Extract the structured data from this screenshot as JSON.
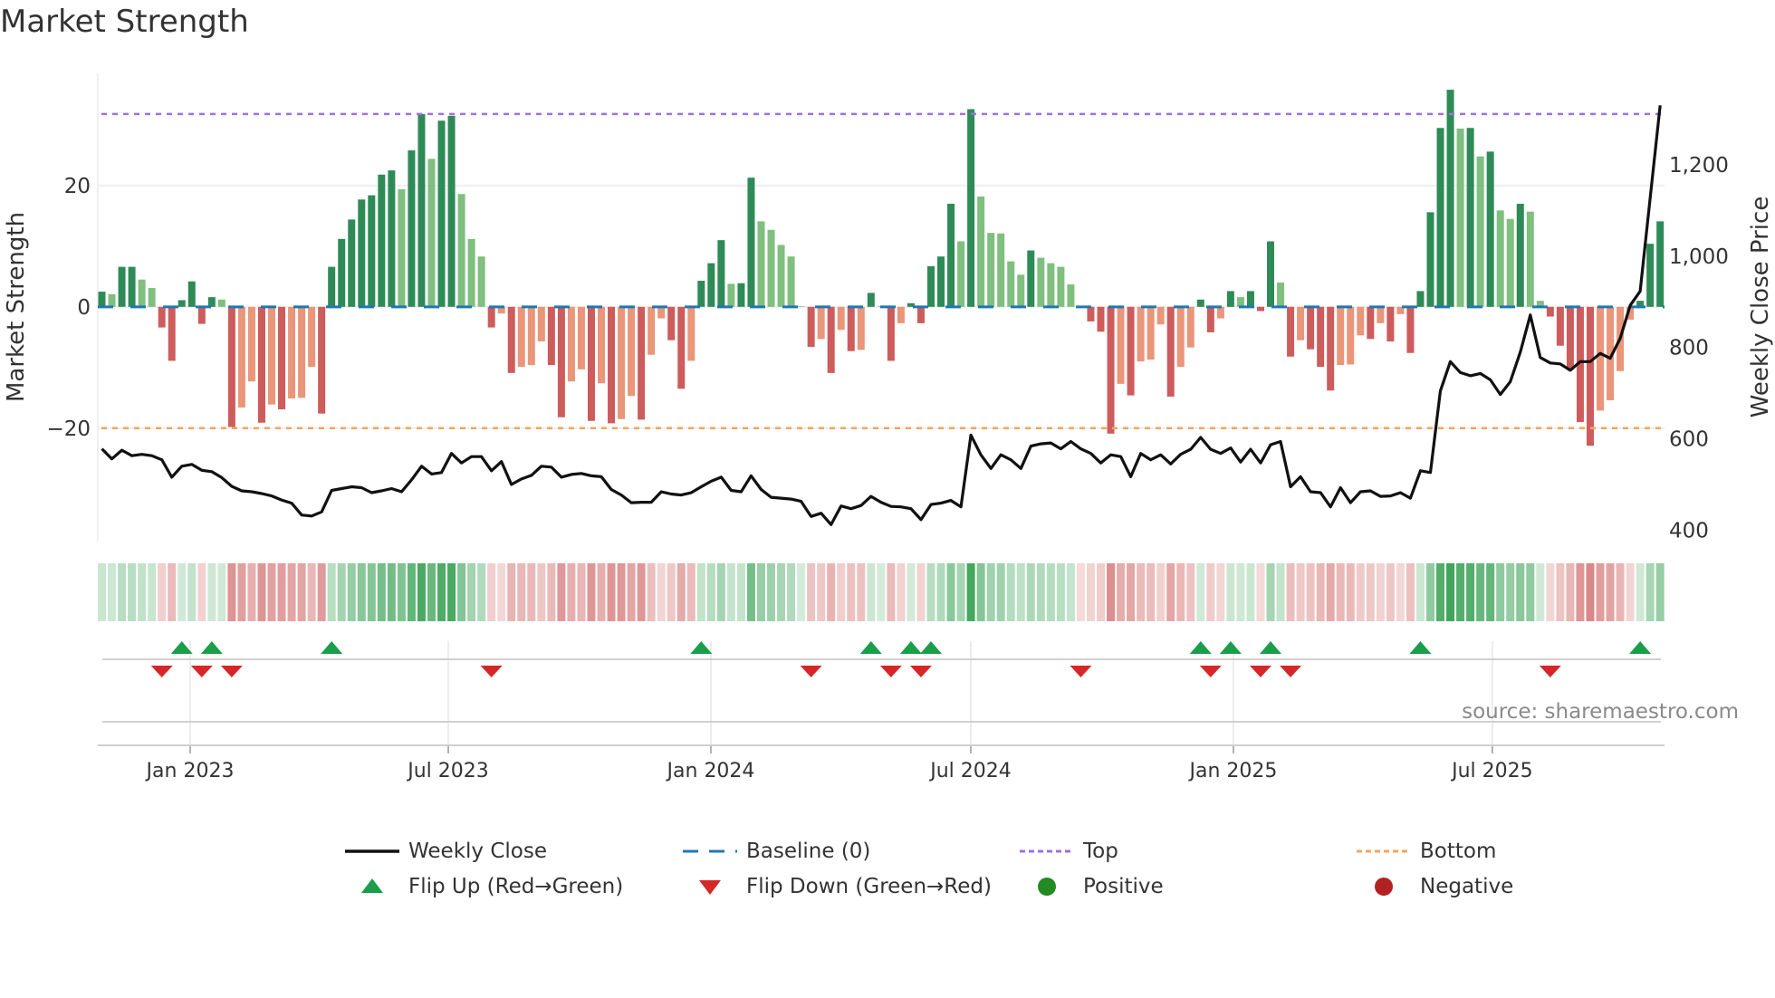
{
  "title": "Market Strength",
  "source": "source: sharemaestro.com",
  "legend": {
    "weekly_close": "Weekly Close",
    "baseline": "Baseline (0)",
    "top": "Top",
    "bottom": "Bottom",
    "flip_up": "Flip Up (Red→Green)",
    "flip_down": "Flip Down (Green→Red)",
    "positive": "Positive",
    "negative": "Negative"
  },
  "colors": {
    "rising_positive": "#2e8b57",
    "falling_positive": "#7fbf7f",
    "falling_negative": "#cd5c5c",
    "rising_negative": "#e9967a",
    "baseline": "#1f77b4",
    "top": "#a070e0",
    "bottom": "#f4a460",
    "line": "#111111",
    "flip_up": "#1a9e4a",
    "flip_down": "#d62728",
    "positive_dot": "#228b22",
    "negative_dot": "#b22222"
  },
  "chart_data": {
    "type": "bar",
    "title": "Market Strength",
    "ylabel": "Market Strength",
    "y2label": "Weekly Close Price",
    "ylim": [
      -38.7,
      38.5
    ],
    "y2lim": [
      375,
      1400
    ],
    "yticks": [
      {
        "v": 20,
        "label": "20"
      },
      {
        "v": 0,
        "label": "0"
      },
      {
        "v": -20,
        "label": "−20"
      }
    ],
    "y2ticks": [
      {
        "v": 1200,
        "label": "1,200"
      },
      {
        "v": 1000,
        "label": "1,000"
      },
      {
        "v": 800,
        "label": "800"
      },
      {
        "v": 600,
        "label": "600"
      },
      {
        "v": 400,
        "label": "400"
      }
    ],
    "top_level": 31.8,
    "bottom_level": -20,
    "xticks": [
      {
        "week": 8.84,
        "label": "Jan 2023"
      },
      {
        "week": 34.68,
        "label": "Jul 2023"
      },
      {
        "week": 60.97,
        "label": "Jan 2024"
      },
      {
        "week": 86.99,
        "label": "Jul 2024"
      },
      {
        "week": 113.28,
        "label": "Jan 2025"
      },
      {
        "week": 139.2,
        "label": "Jul 2025"
      }
    ],
    "strength": [
      2.5,
      2.1,
      6.6,
      6.6,
      4.5,
      3.1,
      -3.4,
      -8.9,
      1.1,
      4.2,
      -2.8,
      1.6,
      1.2,
      -19.8,
      -16.6,
      -12.3,
      -19.1,
      -16.1,
      -16.9,
      -15.1,
      -15.0,
      -9.9,
      -17.6,
      6.6,
      11.2,
      14.4,
      17.7,
      18.4,
      21.8,
      22.5,
      19.4,
      25.8,
      31.8,
      24.4,
      30.7,
      31.5,
      18.6,
      11.2,
      8.3,
      -3.4,
      -1.1,
      -10.9,
      -9.9,
      -9.6,
      -5.7,
      -9.6,
      -18.2,
      -12.3,
      -10.3,
      -18.8,
      -12.6,
      -19.2,
      -18.5,
      -14.7,
      -18.6,
      -7.9,
      -1.9,
      -5.5,
      -13.5,
      -8.9,
      4.3,
      7.2,
      11.0,
      3.8,
      3.9,
      21.3,
      14.1,
      12.7,
      10.2,
      8.3,
      0.1,
      -6.6,
      -5.3,
      -10.9,
      -3.8,
      -7.3,
      -7.1,
      2.3,
      0.1,
      -8.9,
      -2.7,
      0.6,
      -2.7,
      6.7,
      8.3,
      17.0,
      10.8,
      32.6,
      18.2,
      12.2,
      12.1,
      7.5,
      5.3,
      9.3,
      8.1,
      7.2,
      6.6,
      3.7,
      -0.1,
      -2.4,
      -4.1,
      -20.9,
      -12.7,
      -14.6,
      -9.0,
      -8.7,
      -2.9,
      -14.8,
      -9.9,
      -6.7,
      1.2,
      -4.2,
      -1.9,
      2.6,
      1.6,
      2.6,
      -0.7,
      10.8,
      4.0,
      -8.2,
      -5.5,
      -7.0,
      -9.9,
      -13.8,
      -9.6,
      -9.5,
      -4.7,
      -5.3,
      -2.7,
      -5.7,
      -1.2,
      -7.6,
      2.6,
      15.6,
      29.5,
      35.8,
      29.4,
      29.5,
      24.8,
      25.6,
      15.9,
      14.5,
      17.0,
      15.7,
      1.0,
      -1.6,
      -6.4,
      -10.3,
      -19.0,
      -22.9,
      -17.1,
      -15.4,
      -10.6,
      -2.1,
      1.0,
      10.4,
      14.1
    ],
    "weekly_close": [
      578,
      556,
      575,
      563,
      566,
      563,
      554,
      516,
      540,
      544,
      531,
      528,
      515,
      496,
      486,
      484,
      480,
      475,
      466,
      459,
      433,
      431,
      440,
      487,
      491,
      495,
      493,
      482,
      486,
      491,
      484,
      510,
      540,
      523,
      526,
      568,
      547,
      561,
      561,
      530,
      550,
      500,
      512,
      520,
      540,
      538,
      516,
      522,
      524,
      519,
      517,
      489,
      477,
      460,
      461,
      461,
      484,
      479,
      477,
      482,
      495,
      507,
      516,
      487,
      484,
      519,
      489,
      472,
      470,
      468,
      463,
      430,
      437,
      412,
      453,
      447,
      454,
      474,
      461,
      452,
      451,
      447,
      423,
      456,
      459,
      465,
      451,
      608,
      565,
      535,
      565,
      554,
      535,
      584,
      589,
      591,
      578,
      594,
      578,
      568,
      547,
      565,
      561,
      517,
      568,
      554,
      565,
      545,
      566,
      577,
      603,
      577,
      568,
      580,
      549,
      577,
      547,
      587,
      594,
      495,
      517,
      484,
      482,
      451,
      493,
      460,
      484,
      486,
      474,
      475,
      482,
      470,
      530,
      526,
      705,
      769,
      745,
      738,
      743,
      729,
      697,
      725,
      790,
      871,
      778,
      766,
      764,
      750,
      769,
      769,
      787,
      776,
      820,
      892,
      923,
      1126,
      1330
    ]
  }
}
